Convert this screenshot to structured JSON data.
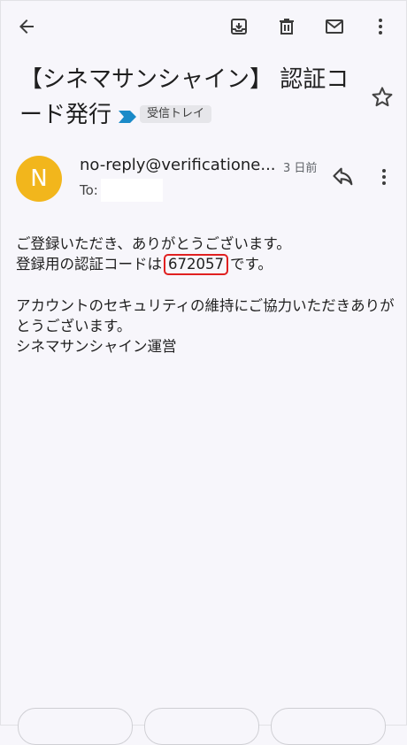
{
  "subject": {
    "title": "【シネマサンシャイン】 認証コード発行",
    "label": "受信トレイ"
  },
  "sender": {
    "avatar_letter": "N",
    "avatar_color": "#f2b61c",
    "name": "no-reply@verificatione...",
    "date": "3 日前",
    "to_label": "To:"
  },
  "body": {
    "line1": "ご登録いただき、ありがとうございます。",
    "line2_prefix": "登録用の認証コードは",
    "code": "672057",
    "line2_suffix": "です。",
    "line3": "アカウントのセキュリティの維持にご協力いただきありがとうございます。",
    "line4": "シネマサンシャイン運営"
  },
  "icons": {
    "back": "arrow-back-icon",
    "archive": "archive-icon",
    "delete": "trash-icon",
    "mail": "mail-icon",
    "more": "more-vert-icon",
    "star": "star-icon",
    "reply": "reply-icon",
    "important": "important-marker-icon"
  },
  "colors": {
    "highlight": "#e02020",
    "important": "#1a8ac8"
  }
}
